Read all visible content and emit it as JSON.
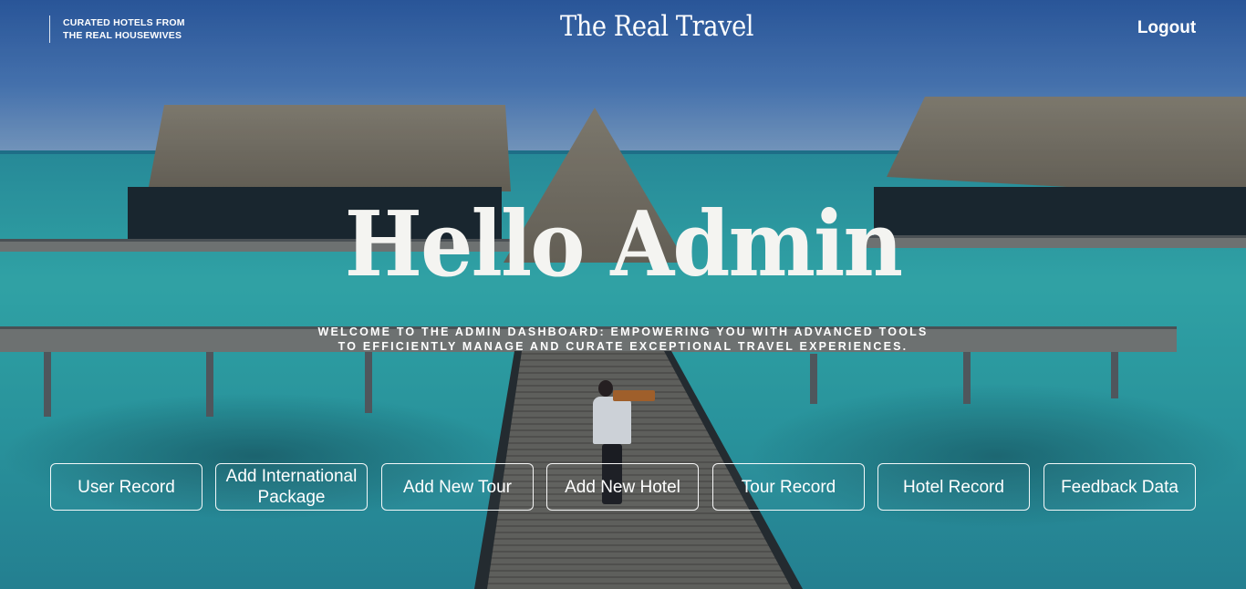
{
  "header": {
    "tagline_line1": "CURATED HOTELS FROM",
    "tagline_line2": "THE REAL HOUSEWIVES",
    "brand": "The Real Travel",
    "logout_label": "Logout"
  },
  "hero": {
    "title": "Hello Admin",
    "subtitle_line1": "WELCOME TO THE ADMIN DASHBOARD: EMPOWERING YOU WITH ADVANCED TOOLS",
    "subtitle_line2": "TO EFFICIENTLY MANAGE AND CURATE EXCEPTIONAL TRAVEL EXPERIENCES."
  },
  "actions": [
    {
      "label": "User Record"
    },
    {
      "label": "Add International Package"
    },
    {
      "label": "Add New Tour"
    },
    {
      "label": "Add New Hotel"
    },
    {
      "label": "Tour Record"
    },
    {
      "label": "Hotel Record"
    },
    {
      "label": "Feedback Data"
    }
  ],
  "colors": {
    "text": "#ffffff",
    "sky": "#4f7fbf",
    "sea": "#37b6b6",
    "button_border": "#ffffff"
  },
  "background": {
    "scene": "overwater bungalows with wooden boardwalk"
  }
}
